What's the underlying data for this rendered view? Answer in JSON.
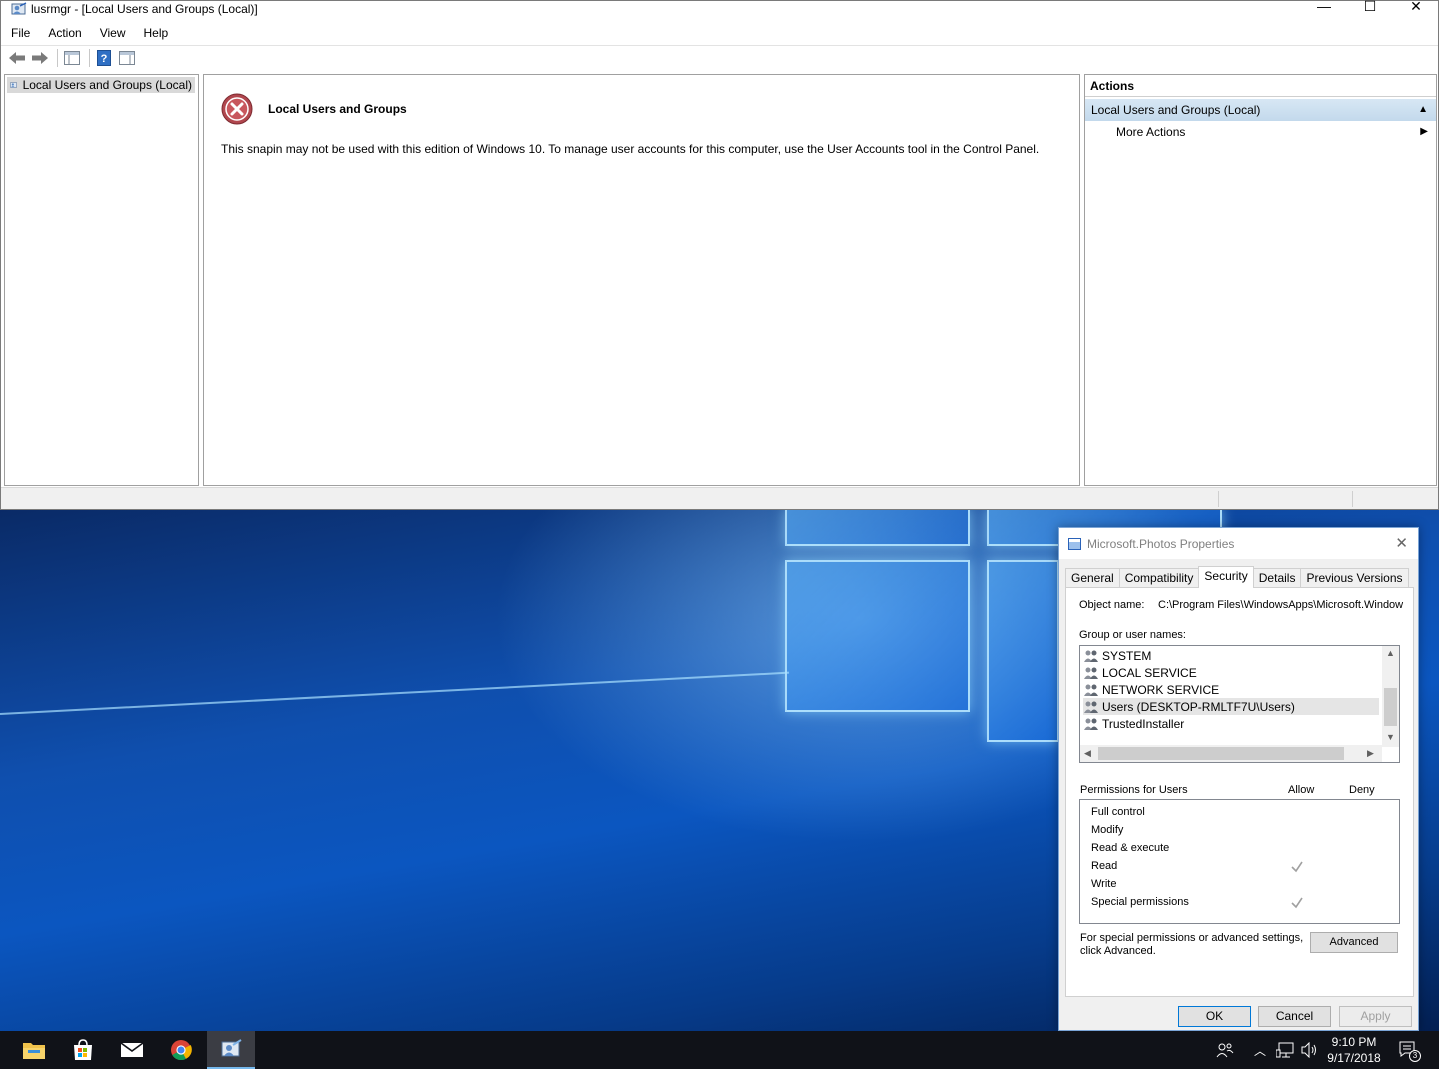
{
  "window": {
    "title": "lusrmgr - [Local Users and Groups (Local)]",
    "controls": {
      "minimize": "—",
      "maximize": "☐",
      "close": "✕"
    }
  },
  "menu": [
    "File",
    "Action",
    "View",
    "Help"
  ],
  "toolbar": {
    "icons": [
      "back-arrow-icon",
      "forward-arrow-icon",
      "show-hide-console-tree-icon",
      "help-icon",
      "show-hide-action-pane-icon"
    ]
  },
  "tree": {
    "root_label": "Local Users and Groups (Local)"
  },
  "content": {
    "heading": "Local Users and Groups",
    "message": "This snapin may not be used with this edition of Windows 10. To manage user accounts for this computer, use the User Accounts tool in the Control Panel."
  },
  "actions": {
    "header": "Actions",
    "section": "Local Users and Groups (Local)",
    "more": "More Actions"
  },
  "dialog": {
    "title": "Microsoft.Photos Properties",
    "tabs": [
      "General",
      "Compatibility",
      "Security",
      "Details",
      "Previous Versions"
    ],
    "active_tab": "Security",
    "object_name_label": "Object name:",
    "object_name_value": "C:\\Program Files\\WindowsApps\\Microsoft.Window",
    "group_label": "Group or user names:",
    "users": [
      "SYSTEM",
      "LOCAL SERVICE",
      "NETWORK SERVICE",
      "Users (DESKTOP-RMLTF7U\\Users)",
      "TrustedInstaller"
    ],
    "selected_user": "Users (DESKTOP-RMLTF7U\\Users)",
    "permissions_label": "Permissions for Users",
    "allow_label": "Allow",
    "deny_label": "Deny",
    "permissions": [
      {
        "name": "Full control",
        "allow": false
      },
      {
        "name": "Modify",
        "allow": false
      },
      {
        "name": "Read & execute",
        "allow": false
      },
      {
        "name": "Read",
        "allow": true
      },
      {
        "name": "Write",
        "allow": false
      },
      {
        "name": "Special permissions",
        "allow": true
      }
    ],
    "advanced_note_line1": "For special permissions or advanced settings,",
    "advanced_note_line2": "click Advanced.",
    "advanced_button": "Advanced",
    "ok_button": "OK",
    "cancel_button": "Cancel",
    "apply_button": "Apply"
  },
  "taskbar": {
    "apps": [
      "file-explorer-icon",
      "store-icon",
      "mail-icon",
      "chrome-icon",
      "lusrmgr-icon"
    ],
    "time": "9:10 PM",
    "date": "9/17/2018",
    "notification_count": "3"
  },
  "colors": {
    "actions_section_bg": "#c3d9ec",
    "desktop_blue": "#0b56c0",
    "taskbar_bg": "#101218",
    "active_accent": "#76b9ed"
  }
}
